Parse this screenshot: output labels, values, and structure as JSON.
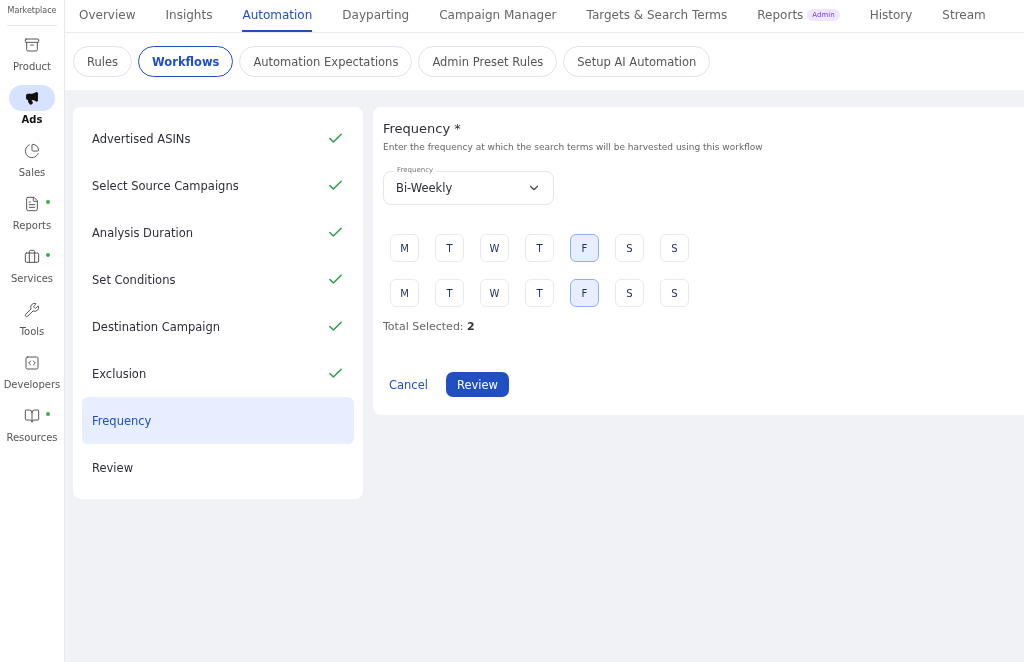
{
  "sidebar": {
    "header": "Marketplace",
    "items": [
      {
        "label": "Product",
        "kind": "archive",
        "selected": false,
        "dot": false
      },
      {
        "label": "Ads",
        "kind": "megaphone",
        "selected": true,
        "dot": false
      },
      {
        "label": "Sales",
        "kind": "pie",
        "selected": false,
        "dot": false
      },
      {
        "label": "Reports",
        "kind": "report",
        "selected": false,
        "dot": true
      },
      {
        "label": "Services",
        "kind": "briefcase",
        "selected": false,
        "dot": true
      },
      {
        "label": "Tools",
        "kind": "tools",
        "selected": false,
        "dot": false
      },
      {
        "label": "Developers",
        "kind": "code",
        "selected": false,
        "dot": false
      },
      {
        "label": "Resources",
        "kind": "book",
        "selected": false,
        "dot": true
      }
    ]
  },
  "nav": [
    {
      "label": "Overview",
      "selected": false
    },
    {
      "label": "Insights",
      "selected": false
    },
    {
      "label": "Automation",
      "selected": true
    },
    {
      "label": "Dayparting",
      "selected": false
    },
    {
      "label": "Campaign Manager",
      "selected": false
    },
    {
      "label": "Targets & Search Terms",
      "selected": false
    },
    {
      "label": "Reports",
      "selected": false,
      "badge": "Admin"
    },
    {
      "label": "History",
      "selected": false
    },
    {
      "label": "Stream",
      "selected": false
    }
  ],
  "subtabs": [
    {
      "label": "Rules",
      "selected": false
    },
    {
      "label": "Workflows",
      "selected": true
    },
    {
      "label": "Automation Expectations",
      "selected": false
    },
    {
      "label": "Admin Preset Rules",
      "selected": false
    },
    {
      "label": "Setup AI Automation",
      "selected": false
    }
  ],
  "steps": [
    {
      "label": "Advertised ASINs",
      "checked": true,
      "selected": false
    },
    {
      "label": "Select Source Campaigns",
      "checked": true,
      "selected": false
    },
    {
      "label": "Analysis Duration",
      "checked": true,
      "selected": false
    },
    {
      "label": "Set Conditions",
      "checked": true,
      "selected": false
    },
    {
      "label": "Destination Campaign",
      "checked": true,
      "selected": false
    },
    {
      "label": "Exclusion",
      "checked": true,
      "selected": false
    },
    {
      "label": "Frequency",
      "checked": false,
      "selected": true
    },
    {
      "label": "Review",
      "checked": false,
      "selected": false
    }
  ],
  "form": {
    "title": "Frequency *",
    "description": "Enter the frequency at which the search terms will be harvested using this workflow",
    "select": {
      "label": "Frequency",
      "value": "Bi-Weekly"
    },
    "weeks": [
      [
        {
          "label": "M",
          "selected": false
        },
        {
          "label": "T",
          "selected": false
        },
        {
          "label": "W",
          "selected": false
        },
        {
          "label": "T",
          "selected": false
        },
        {
          "label": "F",
          "selected": true
        },
        {
          "label": "S",
          "selected": false
        },
        {
          "label": "S",
          "selected": false
        }
      ],
      [
        {
          "label": "M",
          "selected": false
        },
        {
          "label": "T",
          "selected": false
        },
        {
          "label": "W",
          "selected": false
        },
        {
          "label": "T",
          "selected": false
        },
        {
          "label": "F",
          "selected": true
        },
        {
          "label": "S",
          "selected": false
        },
        {
          "label": "S",
          "selected": false
        }
      ]
    ],
    "total": "Total Selected: **2**",
    "cancel": "Cancel",
    "submit": "Review"
  }
}
